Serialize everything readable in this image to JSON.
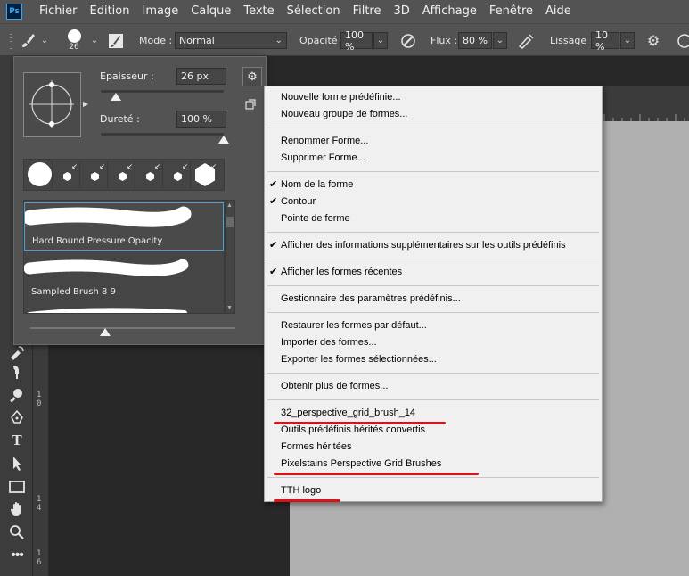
{
  "app": {
    "logo": "Ps",
    "menu": [
      "Fichier",
      "Edition",
      "Image",
      "Calque",
      "Texte",
      "Sélection",
      "Filtre",
      "3D",
      "Affichage",
      "Fenêtre",
      "Aide"
    ]
  },
  "options_bar": {
    "brush_size": "26",
    "mode_label": "Mode :",
    "mode_value": "Normal",
    "opacity_label": "Opacité :",
    "opacity_value": "100 %",
    "flow_label": "Flux :",
    "flow_value": "80 %",
    "smoothing_label": "Lissage :",
    "smoothing_value": "10 %"
  },
  "brush_panel": {
    "size_label": "Epaisseur :",
    "size_value": "26 px",
    "size_level": 0.05,
    "hardness_label": "Dureté :",
    "hardness_value": "100 %",
    "hardness_level": 1.0,
    "brushes": [
      {
        "name": "Hard Round Pressure Opacity"
      },
      {
        "name": "Sampled Brush 8 9"
      }
    ]
  },
  "flyout_menu": {
    "items": [
      {
        "label": "Nouvelle forme prédéfinie...",
        "checked": false
      },
      {
        "label": "Nouveau groupe de formes...",
        "checked": false
      },
      {
        "separator": true
      },
      {
        "label": "Renommer Forme...",
        "checked": false
      },
      {
        "label": "Supprimer Forme...",
        "checked": false
      },
      {
        "separator": true
      },
      {
        "label": "Nom de la forme",
        "checked": true
      },
      {
        "label": "Contour",
        "checked": true
      },
      {
        "label": "Pointe de forme",
        "checked": false
      },
      {
        "separator": true
      },
      {
        "label": "Afficher des informations supplémentaires sur les outils prédéfinis",
        "checked": true
      },
      {
        "separator": true
      },
      {
        "label": "Afficher les formes récentes",
        "checked": true
      },
      {
        "separator": true
      },
      {
        "label": "Gestionnaire des paramètres prédéfinis...",
        "checked": false
      },
      {
        "separator": true
      },
      {
        "label": "Restaurer les formes par défaut...",
        "checked": false
      },
      {
        "label": "Importer des formes...",
        "checked": false
      },
      {
        "label": "Exporter les formes sélectionnées...",
        "checked": false
      },
      {
        "separator": true
      },
      {
        "label": "Obtenir plus de formes...",
        "checked": false
      },
      {
        "separator": true
      },
      {
        "label": "32_perspective_grid_brush_14",
        "checked": false,
        "underlined": true
      },
      {
        "label": "Outils prédéfinis hérités convertis",
        "checked": false
      },
      {
        "label": "Formes héritées",
        "checked": false
      },
      {
        "label": "Pixelstains Perspective Grid Brushes",
        "checked": false,
        "underlined": true
      },
      {
        "separator": true
      },
      {
        "label": "TTH logo",
        "checked": false,
        "underlined": true
      }
    ]
  },
  "ruler": {
    "ticks": [
      "1",
      "0",
      "1",
      "4",
      "1",
      "6"
    ]
  },
  "colors": {
    "annotation": "#d7131b",
    "selection": "#49a2d8",
    "ui": "#535353"
  }
}
